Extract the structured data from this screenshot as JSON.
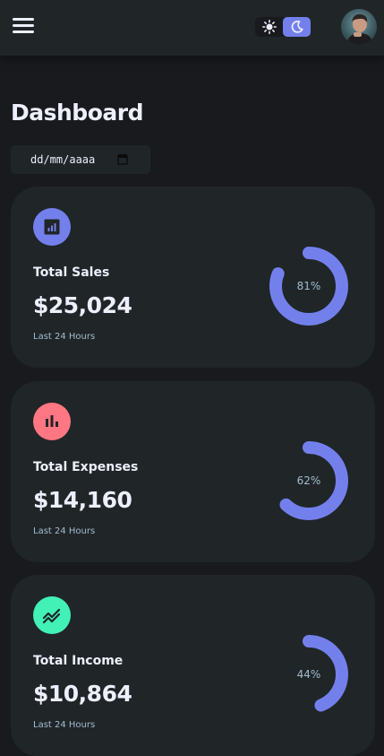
{
  "header": {
    "menu_icon": "hamburger-menu-icon",
    "theme_toggle": {
      "light_icon": "sun-icon",
      "dark_icon": "moon-icon",
      "active": "dark"
    },
    "avatar_icon": "user-avatar"
  },
  "page": {
    "title": "Dashboard"
  },
  "date_filter": {
    "placeholder": "dd/mm/aaaa",
    "icon": "calendar-icon"
  },
  "colors": {
    "primary": "#7380ec",
    "danger": "#ff7782",
    "success": "#41f1b6",
    "card_bg": "#202528",
    "page_bg": "#181a1e"
  },
  "cards": [
    {
      "label": "Total Sales",
      "amount": "$25,024",
      "caption": "Last 24 Hours",
      "percent": 81,
      "percent_label": "81%",
      "icon": "analytics-icon",
      "icon_color": "#7380ec"
    },
    {
      "label": "Total Expenses",
      "amount": "$14,160",
      "caption": "Last 24 Hours",
      "percent": 62,
      "percent_label": "62%",
      "icon": "bar-chart-icon",
      "icon_color": "#ff7782"
    },
    {
      "label": "Total Income",
      "amount": "$10,864",
      "caption": "Last 24 Hours",
      "percent": 44,
      "percent_label": "44%",
      "icon": "trending-up-icon",
      "icon_color": "#41f1b6"
    }
  ]
}
